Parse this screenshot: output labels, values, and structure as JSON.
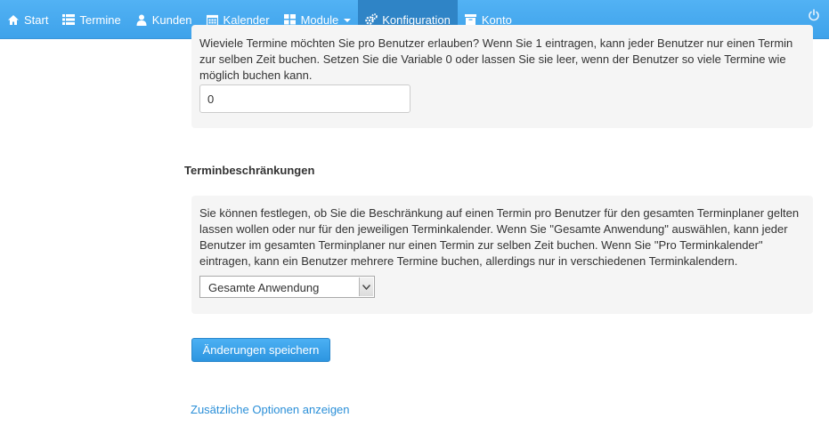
{
  "nav": {
    "items": [
      {
        "label": "Start",
        "icon": "home-icon"
      },
      {
        "label": "Termine",
        "icon": "list-icon"
      },
      {
        "label": "Kunden",
        "icon": "user-icon"
      },
      {
        "label": "Kalender",
        "icon": "calendar-icon"
      },
      {
        "label": "Module",
        "icon": "grid-icon"
      },
      {
        "label": "Konfiguration",
        "icon": "gears-icon"
      },
      {
        "label": "Konto",
        "icon": "box-icon"
      }
    ],
    "active": "Konfiguration",
    "power_icon": "power-icon",
    "colors": {
      "bar": "#4aaaf0",
      "active": "#2f84c6"
    }
  },
  "booking_limit": {
    "help_text_partial": "Wieviele Termine möchten Sie pro Benutzer erlauben? Wenn Sie 1 eintragen, kann jeder Benutzer nur einen Termin zur selben Zeit buchen. Setzen Sie die Variable 0 oder lassen Sie sie leer, wenn der Benutzer so viele Termine wie möglich buchen kann.",
    "value": "0"
  },
  "restrictions": {
    "title": "Terminbeschränkungen",
    "help_text": "Sie können festlegen, ob Sie die Beschränkung auf einen Termin pro Benutzer für den gesamten Terminplaner gelten lassen wollen oder nur für den jeweiligen Terminkalender. Wenn Sie \"Gesamte Anwendung\" auswählen, kann jeder Benutzer im gesamten Terminplaner nur einen Termin zur selben Zeit buchen. Wenn Sie \"Pro Terminkalender\" eintragen, kann ein Benutzer mehrere Termine buchen, allerdings nur in verschiedenen Terminkalendern.",
    "selected": "Gesamte Anwendung"
  },
  "save_label": "Änderungen speichern",
  "more_options_label": "Zusätzliche Optionen anzeigen",
  "accent": "#2a8fd8"
}
